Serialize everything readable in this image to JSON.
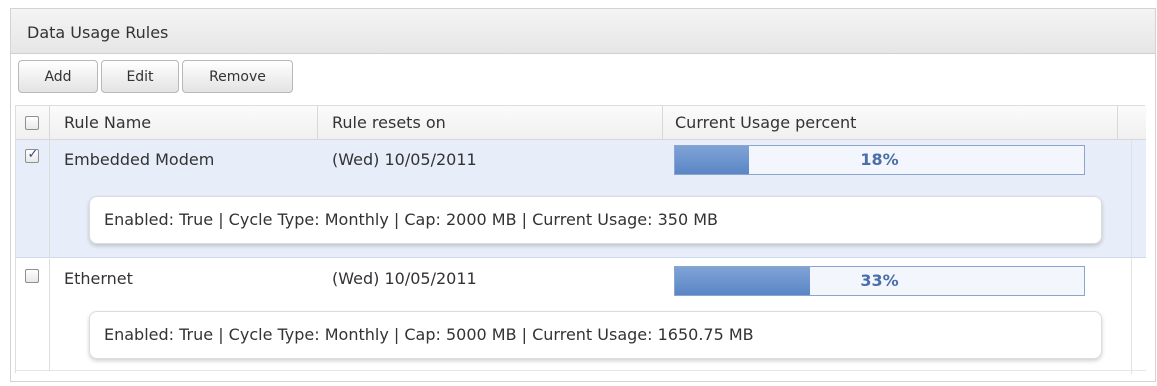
{
  "panel": {
    "title": "Data Usage Rules"
  },
  "toolbar": {
    "add_label": "Add",
    "edit_label": "Edit",
    "remove_label": "Remove"
  },
  "table": {
    "columns": [
      "Rule Name",
      "Rule resets on",
      "Current Usage percent"
    ],
    "select_all_checked": false,
    "rows": [
      {
        "checked": true,
        "selected": true,
        "name": "Embedded Modem",
        "resets_on": "(Wed) 10/05/2011",
        "usage_percent": 18,
        "usage_label": "18%",
        "details": "Enabled: True | Cycle Type: Monthly | Cap: 2000 MB | Current Usage: 350 MB"
      },
      {
        "checked": false,
        "selected": false,
        "name": "Ethernet",
        "resets_on": "(Wed) 10/05/2011",
        "usage_percent": 33,
        "usage_label": "33%",
        "details": "Enabled: True | Cycle Type: Monthly | Cap: 5000 MB | Current Usage: 1650.75 MB"
      }
    ]
  },
  "colors": {
    "selected_row": "#e7eef9",
    "progress_fill": "#5b86c6",
    "progress_text": "#4a6ea9"
  }
}
